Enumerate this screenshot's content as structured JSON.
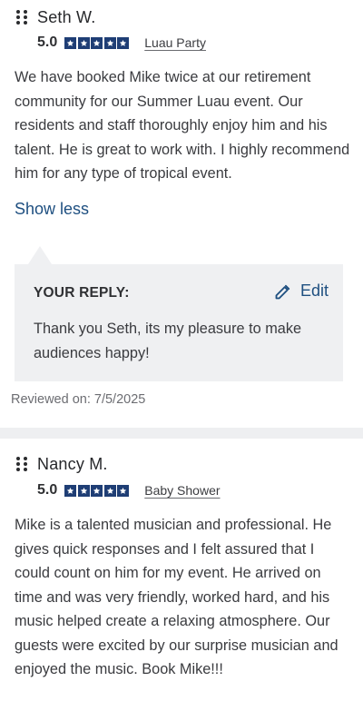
{
  "reviews": [
    {
      "author": "Seth W.",
      "rating": "5.0",
      "stars": 5,
      "event_tag": "Luau Party",
      "text": "We have booked Mike twice at our retirement community for our Summer Luau event. Our residents and staff thoroughly enjoy him and his talent. He is great to work with. I highly recommend him for any type of tropical event.",
      "toggle_label": "Show less",
      "reply": {
        "title": "YOUR REPLY:",
        "edit_label": "Edit",
        "text": "Thank you Seth, its my pleasure to make audiences happy!"
      },
      "reviewed_on": "Reviewed on: 7/5/2025"
    },
    {
      "author": "Nancy M.",
      "rating": "5.0",
      "stars": 5,
      "event_tag": "Baby Shower",
      "text": "Mike is a talented musician and professional. He gives quick responses and I felt assured that I could count on him for my event. He arrived on time and was very friendly, worked hard, and his music helped create a relaxing atmosphere. Our guests were excited by our surprise musician and enjoyed the music. Book Mike!!!"
    }
  ],
  "colors": {
    "star_fill": "#1f3e75",
    "link": "#1e4f80",
    "reply_bg": "#eff0f2",
    "divider": "#eeeff1"
  },
  "icons": {
    "drag_handle": "drag-handle-icon",
    "star": "star-icon",
    "edit": "pencil-icon"
  }
}
